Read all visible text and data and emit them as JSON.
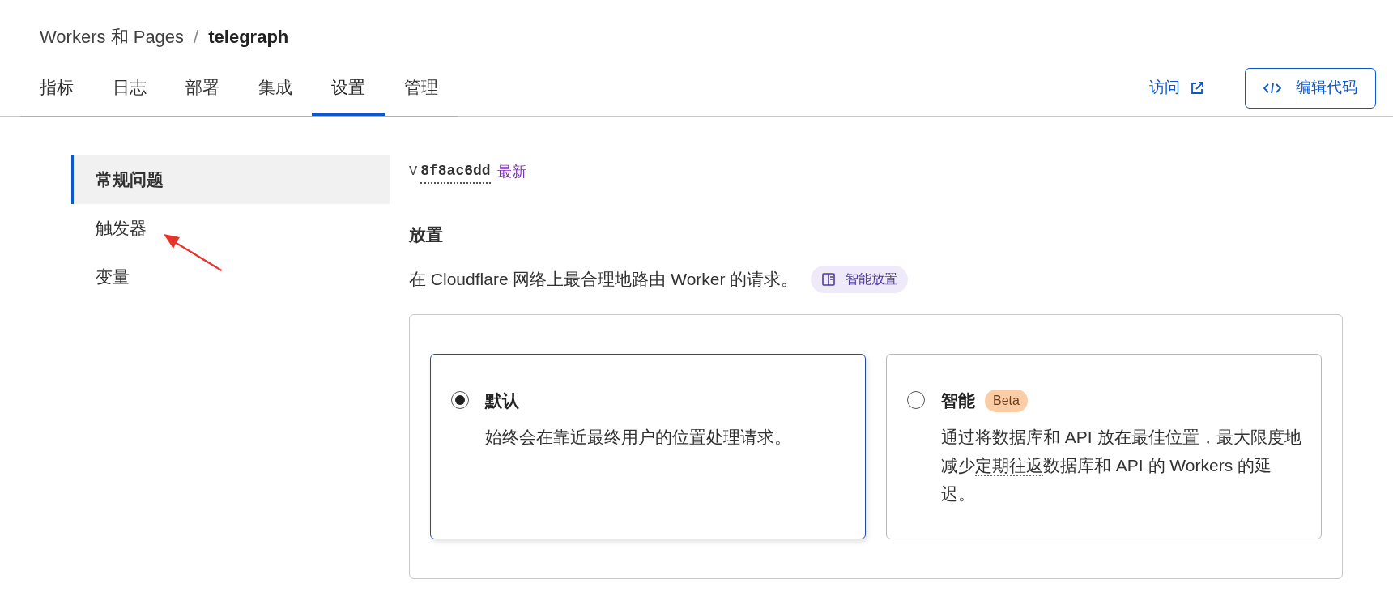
{
  "breadcrumb": {
    "parent": "Workers 和 Pages",
    "separator": "/",
    "current": "telegraph"
  },
  "tabs": [
    {
      "label": "指标",
      "selected": false
    },
    {
      "label": "日志",
      "selected": false
    },
    {
      "label": "部署",
      "selected": false
    },
    {
      "label": "集成",
      "selected": false
    },
    {
      "label": "设置",
      "selected": true
    },
    {
      "label": "管理",
      "selected": false
    }
  ],
  "visit_link": "访问",
  "edit_button": "编辑代码",
  "sidebar": {
    "items": [
      {
        "label": "常规问题",
        "selected": true
      },
      {
        "label": "触发器",
        "selected": false
      },
      {
        "label": "变量",
        "selected": false
      }
    ]
  },
  "version": {
    "prefix": "V",
    "hash": "8f8ac6dd",
    "tag": "最新"
  },
  "placement": {
    "title": "放置",
    "description": "在 Cloudflare 网络上最合理地路由 Worker 的请求。",
    "doc_tag": "智能放置",
    "options": [
      {
        "title": "默认",
        "selected": true,
        "description": [
          {
            "text": "始终会在靠近最终用户的位置处理请求。",
            "underlined": false
          }
        ]
      },
      {
        "title": "智能",
        "selected": false,
        "badge": "Beta",
        "description": [
          {
            "text": "通过将数据库和 API 放在最佳位置，最大限度地减少",
            "underlined": false
          },
          {
            "text": "定期往返",
            "underlined": true
          },
          {
            "text": "数据库和 API 的 Workers 的延迟。",
            "underlined": false
          }
        ]
      }
    ]
  }
}
